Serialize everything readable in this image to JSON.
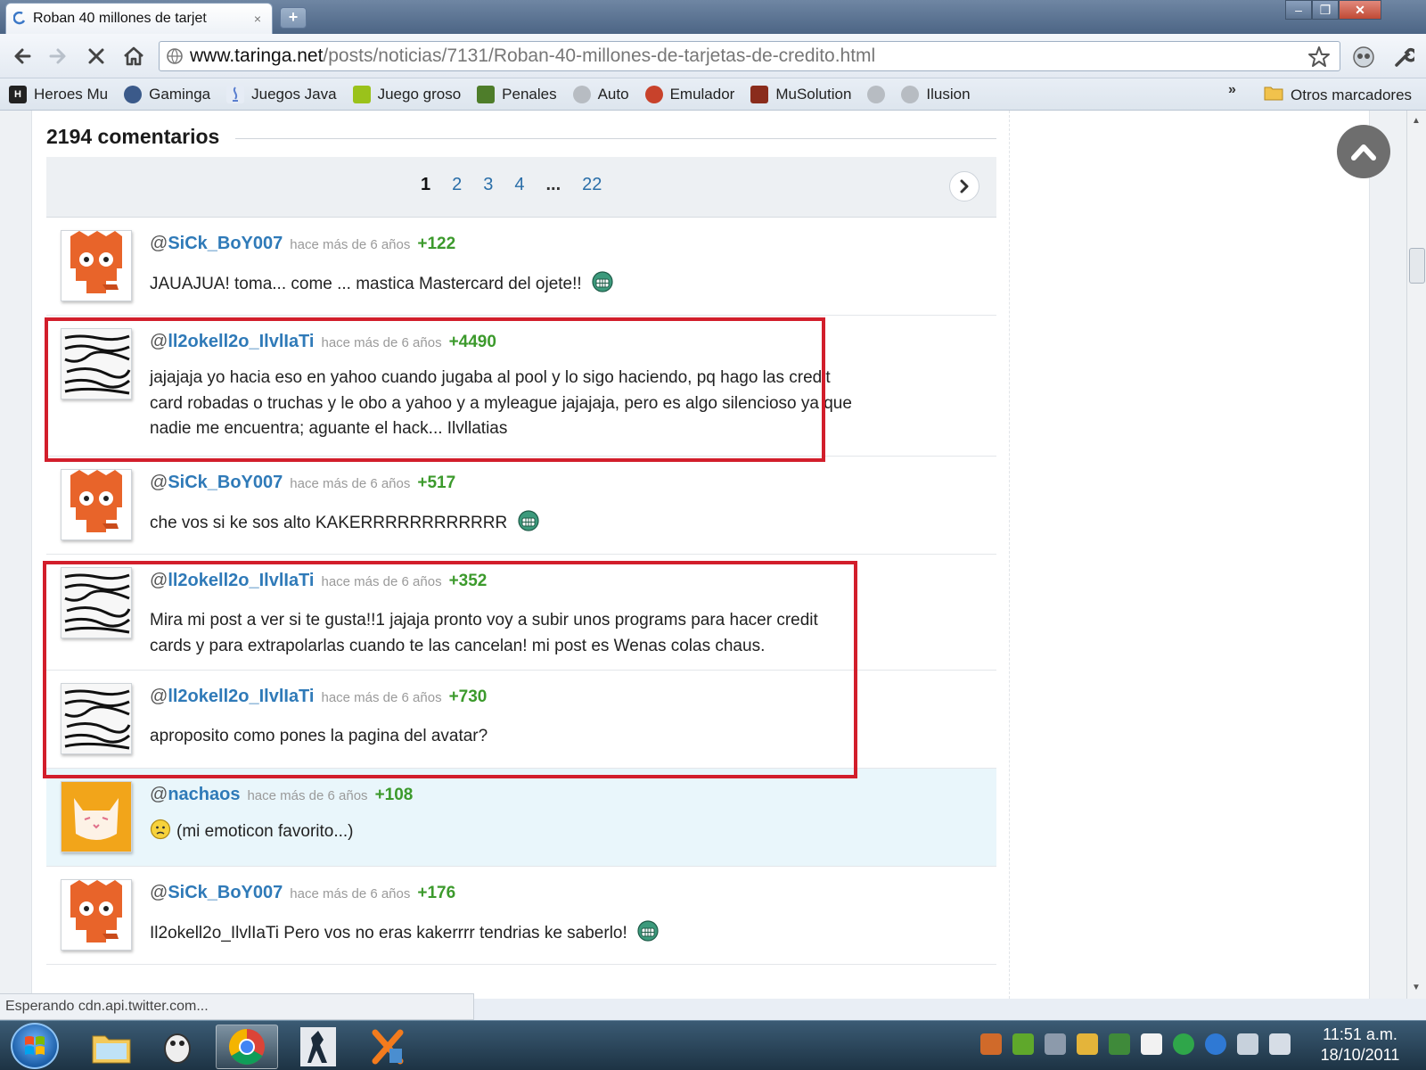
{
  "window": {
    "tab_title": "Roban 40 millones de tarjet",
    "tab_close": "×",
    "new_tab": "+",
    "controls": {
      "minimize": "–",
      "maximize": "❐",
      "close": "✕"
    }
  },
  "toolbar": {
    "url_host": "www.taringa.net",
    "url_path": "/posts/noticias/7131/Roban-40-millones-de-tarjetas-de-credito.html"
  },
  "bookmarks": {
    "items": [
      {
        "label": "Heroes Mu",
        "icon": "H"
      },
      {
        "label": "Gaminga",
        "icon": ""
      },
      {
        "label": "Juegos Java",
        "icon": ""
      },
      {
        "label": "Juego groso",
        "icon": ""
      },
      {
        "label": "Penales",
        "icon": ""
      },
      {
        "label": "Auto",
        "icon": ""
      },
      {
        "label": "Emulador",
        "icon": ""
      },
      {
        "label": "MuSolution",
        "icon": ""
      },
      {
        "label": "",
        "icon": ""
      },
      {
        "label": "Ilusion",
        "icon": ""
      }
    ],
    "overflow": "»",
    "other": "Otros marcadores"
  },
  "comments_header": {
    "title": "2194 comentarios"
  },
  "pagination": {
    "current": "1",
    "pages": [
      "2",
      "3",
      "4"
    ],
    "dots": "...",
    "last": "22"
  },
  "comments": [
    {
      "at": "@",
      "user": "SiCk_BoY007",
      "time": "hace más de 6 años",
      "score": "+122",
      "text": "JAUAJUA! toma... come ... mastica Mastercard del ojete!!",
      "avatar": "orange-face"
    },
    {
      "at": "@",
      "user": "ll2okell2o_IlvlIaTi",
      "time": "hace más de 6 años",
      "score": "+4490",
      "text": "jajajaja yo hacia eso en yahoo cuando jugaba al pool y lo sigo haciendo, pq hago las credit card robadas o truchas y le obo a yahoo y a myleague jajajaja, pero es algo silencioso ya que nadie me encuentra; aguante el hack... Ilvllatias",
      "avatar": "sketch"
    },
    {
      "at": "@",
      "user": "SiCk_BoY007",
      "time": "hace más de 6 años",
      "score": "+517",
      "text": "che vos si ke sos alto KAKERRRRRRRRRRRR",
      "avatar": "orange-face"
    },
    {
      "at": "@",
      "user": "ll2okell2o_IlvlIaTi",
      "time": "hace más de 6 años",
      "score": "+352",
      "text": "Mira mi post a ver si te gusta!!1 jajaja pronto voy a subir unos programs para hacer credit cards y para extrapolarlas cuando te las cancelan! mi post es Wenas colas chaus.",
      "avatar": "sketch"
    },
    {
      "at": "@",
      "user": "ll2okell2o_IlvlIaTi",
      "time": "hace más de 6 años",
      "score": "+730",
      "text": "aproposito como pones la pagina del avatar?",
      "avatar": "sketch"
    },
    {
      "at": "@",
      "user": "nachaos",
      "time": "hace más de 6 años",
      "score": "+108",
      "text": "(mi emoticon favorito...)",
      "avatar": "cat"
    },
    {
      "at": "@",
      "user": "SiCk_BoY007",
      "time": "hace más de 6 años",
      "score": "+176",
      "text": "Il2okell2o_IlvlIaTi Pero vos no eras kakerrrr tendrias ke saberlo!",
      "avatar": "orange-face"
    }
  ],
  "status": {
    "text": "Esperando cdn.api.twitter.com..."
  },
  "clock": {
    "time": "11:51 a.m.",
    "date": "18/10/2011"
  },
  "colors": {
    "highlight_box": "#d21e2b",
    "username": "#2f7ab8",
    "score": "#3c9a2c",
    "highlight_row": "#e9f6fb"
  }
}
